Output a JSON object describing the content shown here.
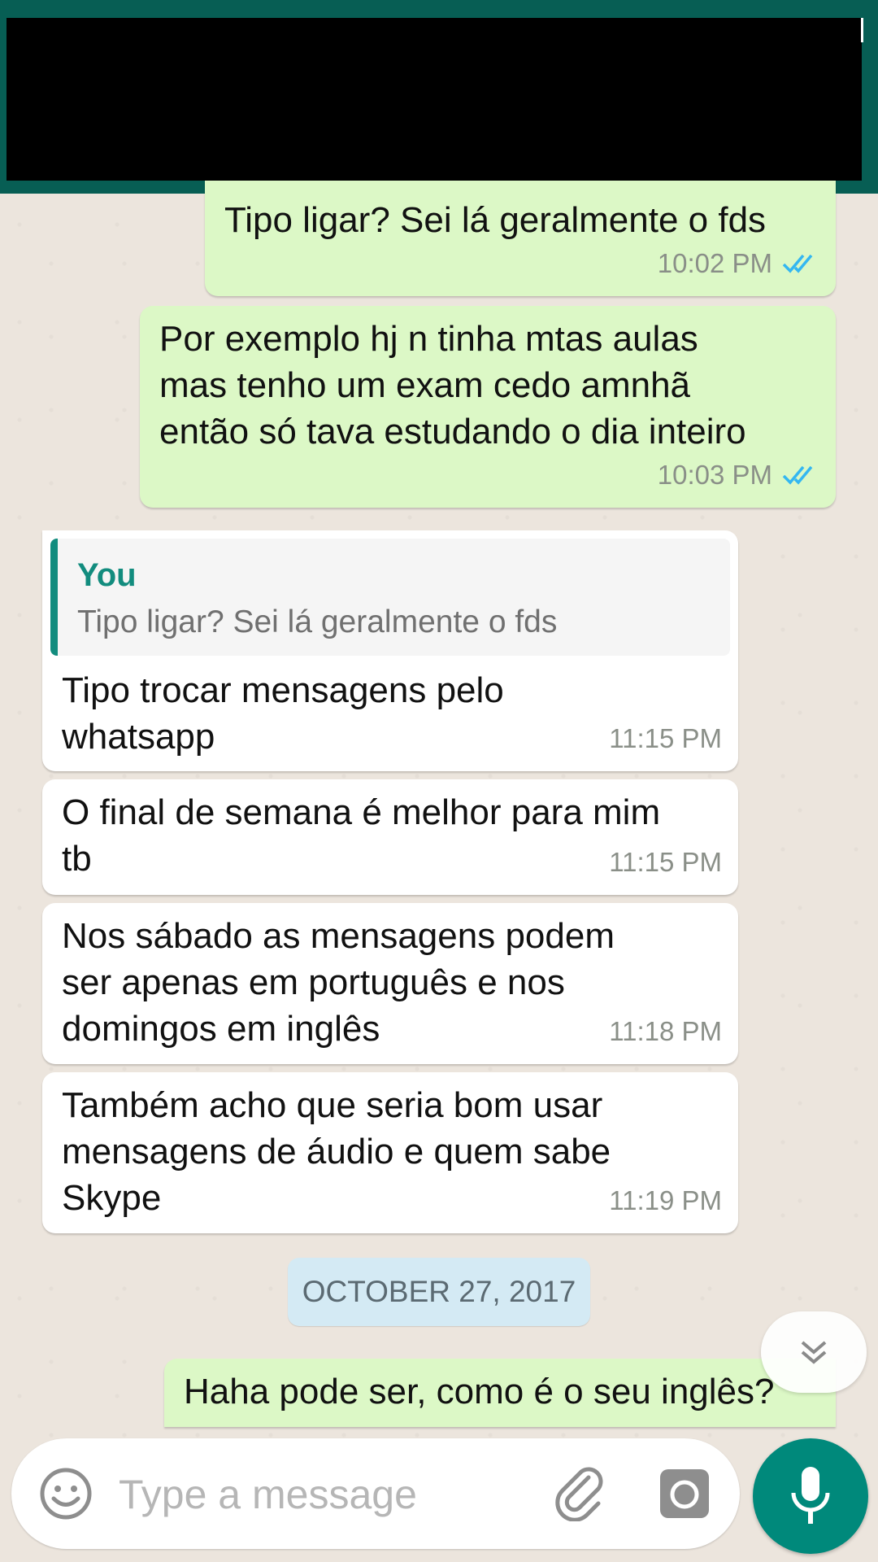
{
  "messages": [
    {
      "direction": "out",
      "text": "Tipo ligar? Sei lá geralmente o fds",
      "time": "10:02 PM",
      "read": true
    },
    {
      "direction": "out",
      "text": "Por exemplo hj n tinha mtas aulas\nmas tenho um exam cedo amnhã\nentão só tava estudando o dia inteiro",
      "time": "10:03 PM",
      "read": true
    },
    {
      "direction": "in",
      "quote": {
        "author": "You",
        "text": "Tipo ligar? Sei lá geralmente o fds"
      },
      "text": "Tipo trocar mensagens pelo\nwhatsapp",
      "time": "11:15 PM"
    },
    {
      "direction": "in",
      "text": "O final de semana é melhor para mim\ntb",
      "time": "11:15 PM"
    },
    {
      "direction": "in",
      "text": "Nos sábado as mensagens podem\nser apenas em português e nos\ndomingos em inglês",
      "time": "11:18 PM"
    },
    {
      "direction": "in",
      "text": "Também acho que seria bom usar\nmensagens de áudio e quem sabe\nSkype",
      "time": "11:19 PM"
    },
    {
      "direction": "out",
      "text": "Haha pode ser, como é o seu inglês?"
    }
  ],
  "date_separator": "OCTOBER 27, 2017",
  "composer": {
    "placeholder": "Type a message"
  },
  "icons": {
    "emoji": "emoji-icon",
    "attach": "paperclip-icon",
    "camera": "camera-icon",
    "mic": "microphone-icon",
    "scroll": "double-chevron-down-icon",
    "read_receipt": "double-check-icon"
  },
  "colors": {
    "header": "#075e54",
    "outgoing_bubble": "#dcf8c6",
    "incoming_bubble": "#ffffff",
    "read_tick": "#34b7f1",
    "accent": "#128c7e",
    "mic_button": "#00897b",
    "wallpaper": "#ece5dd"
  }
}
